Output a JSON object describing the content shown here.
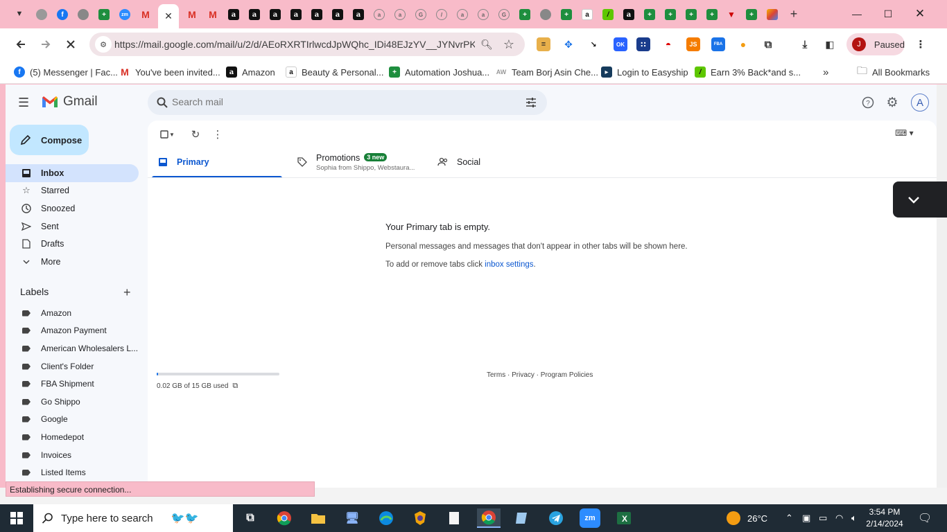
{
  "browser": {
    "url": "https://mail.google.com/mail/u/2/d/AEoRXRTIrlwcdJpWQhc_IDi48EJzYV__JYNvrPK...",
    "profile_initial": "J",
    "profile_status": "Paused",
    "accent": "#f8bbc9"
  },
  "bookmarks": [
    {
      "label": "(5) Messenger | Fac...",
      "icon": "facebook-icon"
    },
    {
      "label": "You've been invited...",
      "icon": "gmail-icon"
    },
    {
      "label": "Amazon",
      "icon": "amazon-icon"
    },
    {
      "label": "Beauty & Personal...",
      "icon": "amazon-smile-icon"
    },
    {
      "label": "Automation Joshua...",
      "icon": "sheets-icon"
    },
    {
      "label": "Team Borj Asin Che...",
      "icon": "team-icon"
    },
    {
      "label": "Login to Easyship",
      "icon": "easyship-icon"
    },
    {
      "label": "Earn 3% Back*and s...",
      "icon": "cashback-icon"
    }
  ],
  "all_bookmarks": "All Bookmarks",
  "gmail": {
    "app_name": "Gmail",
    "search_placeholder": "Search mail",
    "account_initial": "A",
    "compose": "Compose",
    "nav": [
      {
        "label": "Inbox",
        "icon": "inbox-icon"
      },
      {
        "label": "Starred",
        "icon": "star-icon"
      },
      {
        "label": "Snoozed",
        "icon": "clock-icon"
      },
      {
        "label": "Sent",
        "icon": "send-icon"
      },
      {
        "label": "Drafts",
        "icon": "draft-icon"
      },
      {
        "label": "More",
        "icon": "chevron-down-icon"
      }
    ],
    "labels_heading": "Labels",
    "labels": [
      "Amazon",
      "Amazon Payment",
      "American Wholesalers L...",
      "Client's Folder",
      "FBA Shipment",
      "Go Shippo",
      "Google",
      "Homedepot",
      "Invoices",
      "Listed Items"
    ],
    "tabs": {
      "primary": "Primary",
      "promotions": "Promotions",
      "promotions_badge": "3 new",
      "promotions_sub": "Sophia from Shippo, Webstaura...",
      "social": "Social"
    },
    "empty": {
      "title": "Your Primary tab is empty.",
      "message": "Personal messages and messages that don't appear in other tabs will be shown here.",
      "settings_prefix": "To add or remove tabs click ",
      "settings_link": "inbox settings",
      "settings_suffix": "."
    },
    "storage": "0.02 GB of 15 GB used",
    "storage_fraction": 0.0013,
    "footer": "Terms · Privacy · Program Policies"
  },
  "status_text": "Establishing secure connection...",
  "taskbar": {
    "search_placeholder": "Type here to search",
    "weather": "26°C",
    "time": "3:54 PM",
    "date": "2/14/2024"
  }
}
